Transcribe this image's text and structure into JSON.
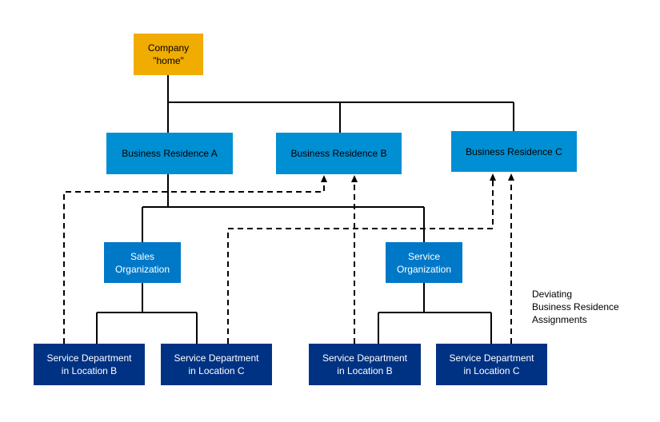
{
  "colors": {
    "company": "#F0AC00",
    "business_residence": "#008FD3",
    "organization": "#0078C8",
    "department": "#003283"
  },
  "nodes": {
    "company": "Company\n\"home\"",
    "residence_a": "Business Residence A",
    "residence_b": "Business Residence B",
    "residence_c": "Business Residence C",
    "sales_org": "Sales\nOrganization",
    "service_org": "Service\nOrganization",
    "sales_dept_b": "Service Department\nin Location B",
    "sales_dept_c": "Service Department\nin Location C",
    "service_dept_b": "Service Department\nin Location B",
    "service_dept_c": "Service Department\nin Location C"
  },
  "legend_note": "Deviating\nBusiness Residence\nAssignments"
}
